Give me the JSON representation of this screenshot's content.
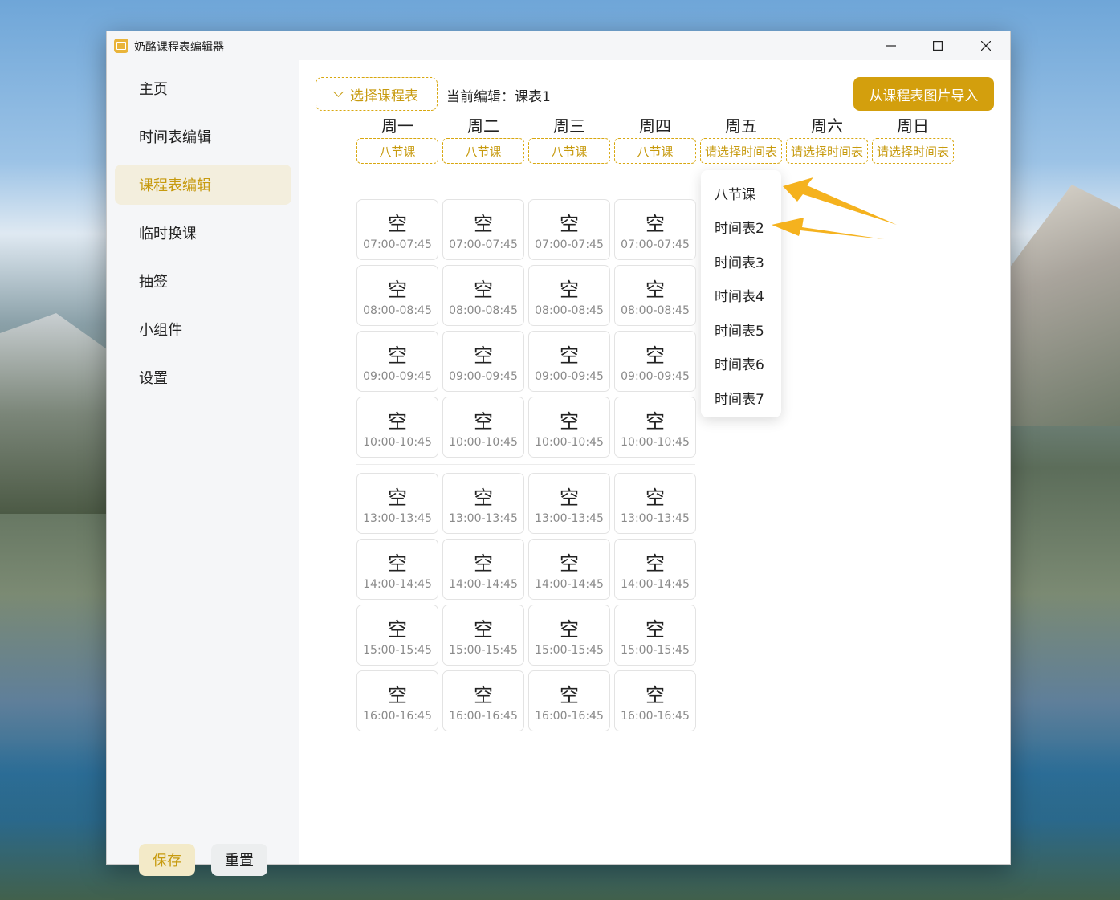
{
  "app": {
    "title": "奶酪课程表编辑器",
    "icon": "calendar-icon"
  },
  "window_controls": {
    "minimize": "—",
    "maximize": "☐",
    "close": "✕"
  },
  "sidebar": {
    "items": [
      {
        "label": "主页",
        "active": false
      },
      {
        "label": "时间表编辑",
        "active": false
      },
      {
        "label": "课程表编辑",
        "active": true
      },
      {
        "label": "临时换课",
        "active": false
      },
      {
        "label": "抽签",
        "active": false
      },
      {
        "label": "小组件",
        "active": false
      },
      {
        "label": "设置",
        "active": false
      }
    ],
    "save_label": "保存",
    "reset_label": "重置"
  },
  "toolbar": {
    "select_label": "选择课程表",
    "editing_text": "当前编辑：课表1",
    "import_label": "从课程表图片导入"
  },
  "days": [
    {
      "name": "周一",
      "timetable": "八节课"
    },
    {
      "name": "周二",
      "timetable": "八节课"
    },
    {
      "name": "周三",
      "timetable": "八节课"
    },
    {
      "name": "周四",
      "timetable": "八节课"
    },
    {
      "name": "周五",
      "timetable": "请选择时间表"
    },
    {
      "name": "周六",
      "timetable": "请选择时间表"
    },
    {
      "name": "周日",
      "timetable": "请选择时间表"
    }
  ],
  "cell_label": "空",
  "periods": [
    "07:00-07:45",
    "08:00-08:45",
    "09:00-09:45",
    "10:00-10:45",
    "13:00-13:45",
    "14:00-14:45",
    "15:00-15:45",
    "16:00-16:45"
  ],
  "dropdown": {
    "options": [
      "八节课",
      "时间表2",
      "时间表3",
      "时间表4",
      "时间表5",
      "时间表6",
      "时间表7"
    ]
  },
  "colors": {
    "accent": "#d39f0d",
    "accent_text": "#c79a0e",
    "annotation_arrow": "#f5b21e"
  }
}
